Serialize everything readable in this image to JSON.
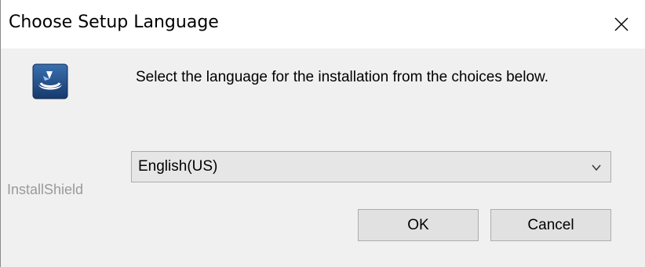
{
  "window": {
    "title": "Choose Setup Language",
    "close_icon": "close-icon"
  },
  "dialog": {
    "icon": "installer-icon",
    "prompt": "Select the language for the installation from the choices below.",
    "brand": "InstallShield",
    "language_select": {
      "selected": "English(US)",
      "icon": "chevron-down-icon"
    },
    "buttons": {
      "ok_label": "OK",
      "cancel_label": "Cancel"
    }
  },
  "colors": {
    "icon_bg": "#1f4e8c",
    "icon_highlight": "#6fa9e6",
    "brand_text": "#9a9a9a",
    "dialog_bg": "#f0f0f0"
  }
}
